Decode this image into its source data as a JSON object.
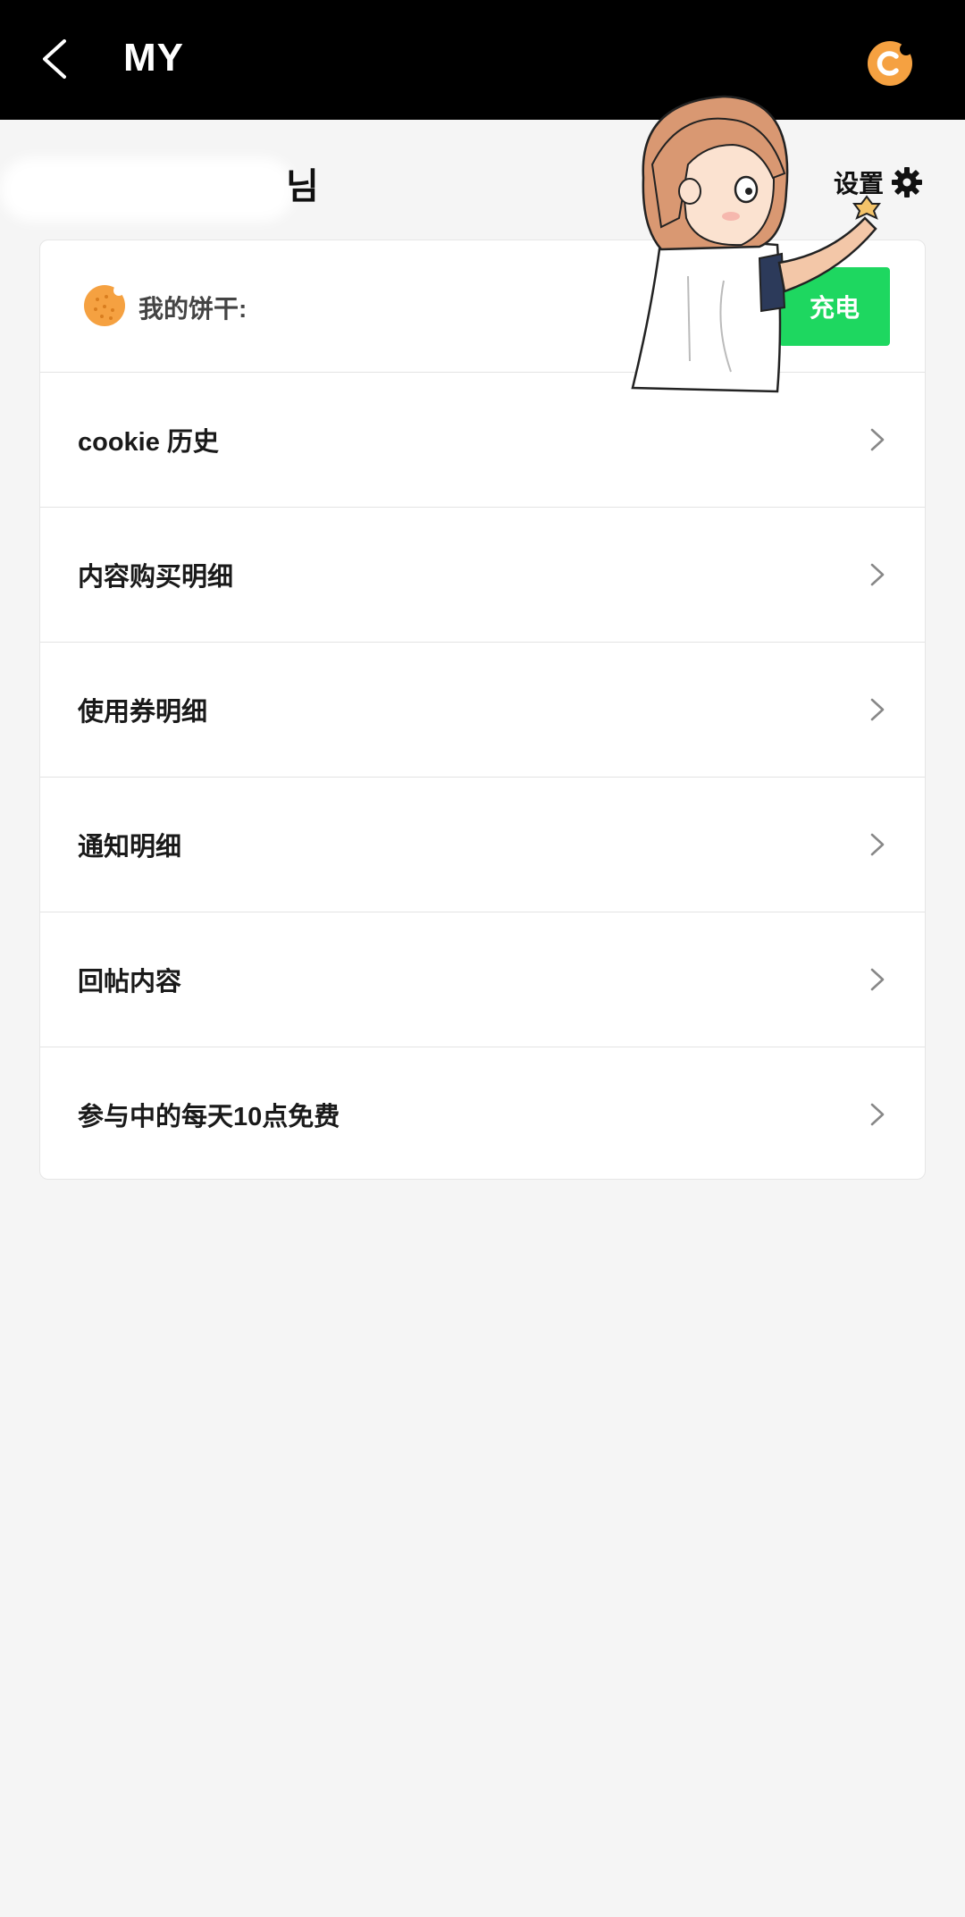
{
  "header": {
    "title": "MY",
    "back_icon": "chevron-left-icon",
    "logo_icon": "cookie-logo-icon"
  },
  "user": {
    "name_suffix": "님",
    "settings_label": "设置",
    "settings_icon": "gear-icon"
  },
  "cookie": {
    "label": "我的饼干:",
    "charge_label": "充电",
    "icon": "cookie-icon"
  },
  "menu": [
    {
      "label": "cookie 历史"
    },
    {
      "label": "内容购买明细"
    },
    {
      "label": "使用券明细"
    },
    {
      "label": "通知明细"
    },
    {
      "label": "回帖内容"
    },
    {
      "label": "参与中的每天10点免费"
    }
  ],
  "colors": {
    "topbar": "#000000",
    "accent_orange": "#f5a141",
    "charge_green": "#1ed760",
    "background": "#f5f5f5"
  }
}
